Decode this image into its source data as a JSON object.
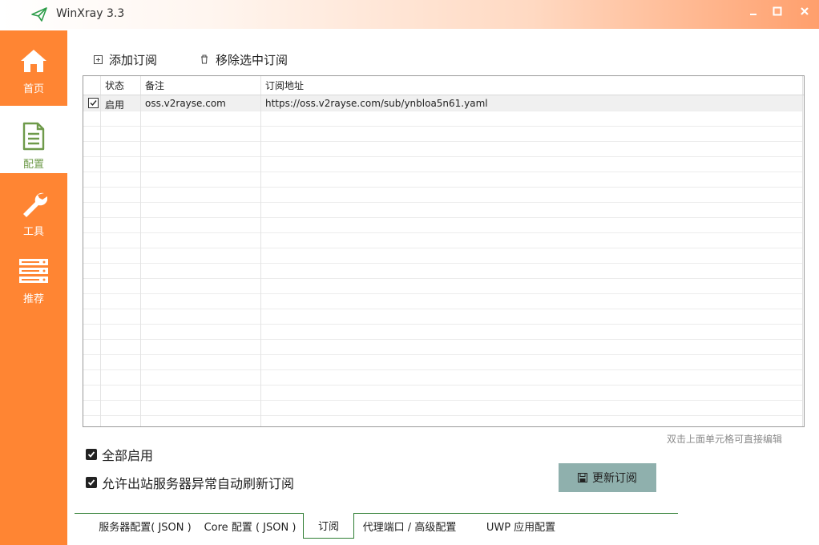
{
  "window": {
    "title": "WinXray 3.3",
    "logo_icon": "paper-plane-icon",
    "controls": [
      "minimize-icon",
      "maximize-icon",
      "close-icon"
    ]
  },
  "sidebar": {
    "accent_color": "#ff8533",
    "items": [
      {
        "label": "首页",
        "icon": "home-icon",
        "active": false
      },
      {
        "label": "配置",
        "icon": "document-icon",
        "active": true
      },
      {
        "label": "工具",
        "icon": "wrench-icon",
        "active": false
      },
      {
        "label": "推荐",
        "icon": "server-icon",
        "active": false
      }
    ]
  },
  "toolbar": {
    "add_label": "添加订阅",
    "add_icon": "add-square-icon",
    "remove_label": "移除选中订阅",
    "remove_icon": "trash-icon"
  },
  "grid": {
    "columns": [
      "状态",
      "备注",
      "订阅地址"
    ],
    "rows": [
      {
        "checked": true,
        "status": "启用",
        "remark": "oss.v2rayse.com",
        "url": "https://oss.v2rayse.com/sub/ynbloa5n61.yaml"
      }
    ]
  },
  "hint": "双击上面单元格可直接编辑",
  "options": {
    "enable_all_label": "全部启用",
    "enable_all_checked": true,
    "auto_refresh_label": "允许出站服务器异常自动刷新订阅",
    "auto_refresh_checked": true
  },
  "update_button": {
    "label": "更新订阅",
    "icon": "save-icon",
    "color": "#8fb0ad"
  },
  "tabs": [
    {
      "label": "服务器配置( JSON )",
      "active": false
    },
    {
      "label": "Core 配置 ( JSON )",
      "active": false
    },
    {
      "label": "订阅",
      "active": true
    },
    {
      "label": "代理端口 / 高级配置",
      "active": false
    },
    {
      "label": "UWP 应用配置",
      "active": false
    }
  ]
}
